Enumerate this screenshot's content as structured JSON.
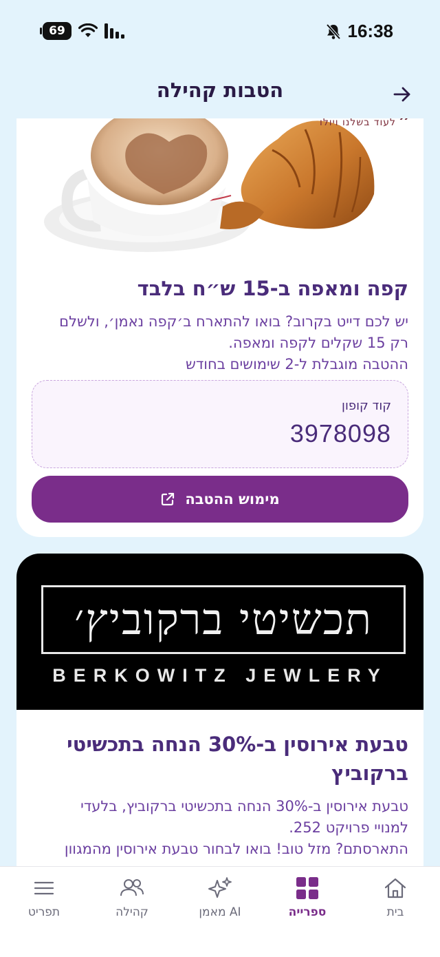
{
  "status_bar": {
    "time": "16:38",
    "battery": "69"
  },
  "header": {
    "title": "הטבות קהילה"
  },
  "offers": [
    {
      "brand_text": "לעוד בשלנו ויולו",
      "title": "קפה ומאפה ב-15 ש״ח בלבד",
      "description": [
        "יש לכם דייט בקרוב? בואו להתארח ב׳קפה נאמן׳, ולשלם",
        "רק 15 שקלים לקפה ומאפה.",
        "ההטבה מוגבלת ל-2 שימושים בחודש"
      ],
      "coupon_label": "קוד קופון",
      "coupon_code": "3978098",
      "redeem_label": "מימוש ההטבה"
    },
    {
      "logo_hebrew": "תכשיטי ברקוביץ׳",
      "logo_english": "BERKOWITZ JEWLERY",
      "title": [
        "טבעת אירוסין ב-30% הנחה בתכשיטי",
        "ברקוביץ"
      ],
      "description": [
        "טבעת אירוסין ב-30% הנחה בתכשיטי ברקוביץ, בלעדי",
        "למנויי פרויקט 252.",
        "התארסתם? מזל טוב! בואו לבחור טבעת אירוסין מהמגוון"
      ]
    }
  ],
  "tabbar": {
    "items": [
      {
        "label": "בית",
        "icon": "home-icon",
        "active": false
      },
      {
        "label": "ספרייה",
        "icon": "library-grid-icon",
        "active": true
      },
      {
        "label": "מאמן AI",
        "icon": "sparkles-icon",
        "active": false
      },
      {
        "label": "קהילה",
        "icon": "community-icon",
        "active": false
      },
      {
        "label": "תפריט",
        "icon": "menu-icon",
        "active": false
      }
    ]
  },
  "colors": {
    "background": "#e3f3fc",
    "accent_purple": "#7a2d8a",
    "title_purple": "#4a2c7a",
    "text_purple": "#6b3fa0"
  }
}
